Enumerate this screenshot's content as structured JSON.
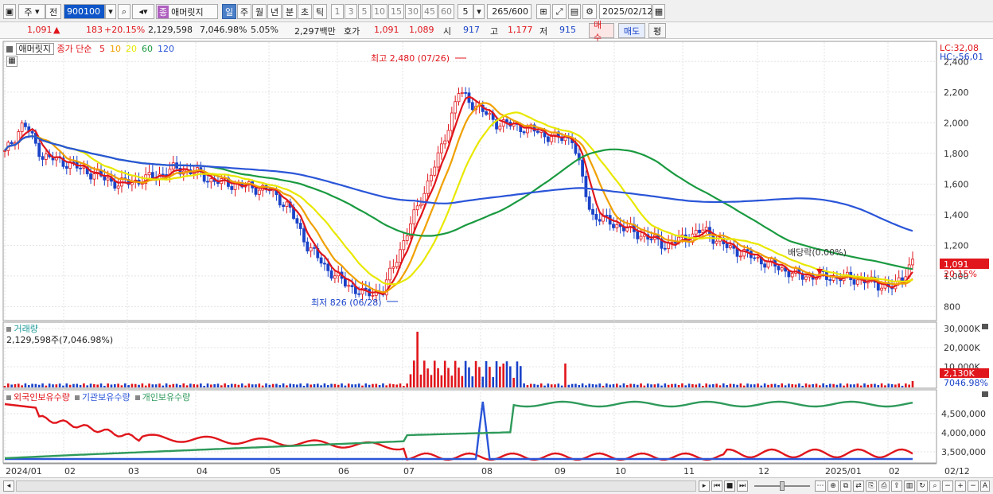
{
  "toolbar": {
    "market_toggle": "주",
    "all_label": "전",
    "code_value": "900100",
    "name_label": "애머릿지",
    "name_badge": "종",
    "period_buttons": [
      "일",
      "주",
      "월",
      "년",
      "분",
      "초",
      "틱"
    ],
    "active_period": "일",
    "tick_buttons": [
      "1",
      "3",
      "5",
      "10",
      "15",
      "30",
      "45",
      "60"
    ],
    "interval_value": "5",
    "count_value": "265",
    "count_total": "/600",
    "date_value": "2025/02/12"
  },
  "quote": {
    "price": "1,091",
    "change": "183",
    "change_pct": "+20.15%",
    "volume": "2,129,598",
    "volume_ratio": "7,046.98%",
    "turnover_ratio": "5.05%",
    "amount": "2,297백만",
    "bid_label": "호가",
    "ask": "1,091",
    "bid": "1,089",
    "open_label": "시",
    "open": "917",
    "high_label": "고",
    "high": "1,177",
    "low_label": "저",
    "low": "915",
    "buy_label": "매수",
    "sell_label": "매도",
    "eval_label": "평"
  },
  "price_panel": {
    "name_tag": "애머릿지",
    "ma_label": "종가 단순",
    "ma_periods": [
      "5",
      "10",
      "20",
      "60",
      "120"
    ],
    "ma_colors": [
      "#e0161c",
      "#f0a000",
      "#e8e800",
      "#1a9a40",
      "#2a55d8"
    ],
    "lc_label": "LC:32,08",
    "hc_label": "HC:-56,01",
    "high_annotation": "최고 2,480 (07/26)",
    "low_annotation": "최저 826 (06/28)",
    "dividend_annotation": "배당락(0.00%)",
    "current_price_tag": "1,091",
    "current_pct_tag": "20.15%",
    "y_ticks": [
      "2,400",
      "2,200",
      "2,000",
      "1,800",
      "1,600",
      "1,400",
      "1,200",
      "1,000",
      "800"
    ]
  },
  "volume_panel": {
    "title": "거래량",
    "value_text": "2,129,598주(7,046.98%)",
    "y_ticks": [
      "30,000K",
      "20,000K",
      "10,000K"
    ],
    "current_tag": "2,130K",
    "current_pct_tag": "7046.98%"
  },
  "holding_panel": {
    "series_labels": [
      "외국인보유수량",
      "기관보유수량",
      "개인보유수량"
    ],
    "series_colors": [
      "#e0161c",
      "#2a55d8",
      "#2e9a5a"
    ],
    "y_ticks": [
      "4,500,000",
      "4,000,000",
      "3,500,000"
    ]
  },
  "x_axis": {
    "labels": [
      "2024/01",
      "02",
      "03",
      "04",
      "05",
      "06",
      "07",
      "08",
      "09",
      "10",
      "11",
      "12",
      "2025/01",
      "02"
    ],
    "right_label": "02/12"
  },
  "chart_data": {
    "type": "line",
    "title": "",
    "xlabel": "",
    "ylabel": "",
    "ylim": [
      750,
      2500
    ],
    "high": {
      "value": 2480,
      "date": "07/26"
    },
    "low": {
      "value": 826,
      "date": "06/28"
    },
    "close_series_approx": [
      1800,
      2000,
      1780,
      1750,
      1700,
      1650,
      1600,
      1620,
      1650,
      1700,
      1680,
      1620,
      1600,
      1580,
      1560,
      1450,
      1200,
      1050,
      950,
      880,
      900,
      1200,
      1500,
      1800,
      2200,
      2100,
      2000,
      1980,
      1950,
      1900,
      1900,
      1400,
      1350,
      1300,
      1250,
      1200,
      1250,
      1300,
      1200,
      1150,
      1100,
      1050,
      1000,
      1000,
      990,
      980,
      950,
      920,
      1091
    ],
    "ma120_approx": [
      1880,
      1850,
      1820,
      1780,
      1750,
      1730,
      1710,
      1700,
      1690,
      1680,
      1650,
      1620,
      1600,
      1580,
      1560,
      1570,
      1590,
      1600,
      1590,
      1560,
      1540,
      1510,
      1490,
      1470,
      1460,
      1440,
      1420,
      1380,
      1290
    ]
  }
}
